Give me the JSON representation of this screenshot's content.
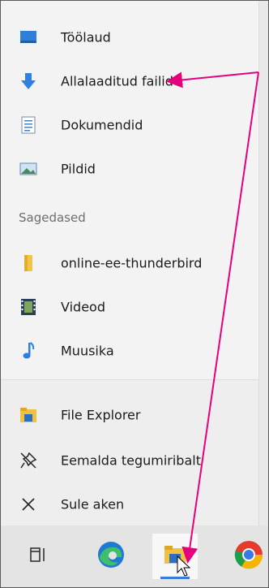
{
  "quick_access": [
    {
      "label": "Töölaud",
      "icon": "desktop-icon"
    },
    {
      "label": "Allalaaditud failid",
      "icon": "download-arrow-icon"
    },
    {
      "label": "Dokumendid",
      "icon": "document-icon"
    },
    {
      "label": "Pildid",
      "icon": "pictures-icon"
    }
  ],
  "frequent": {
    "header": "Sagedased",
    "items": [
      {
        "label": "online-ee-thunderbird",
        "icon": "folder-icon"
      },
      {
        "label": "Videod",
        "icon": "video-icon"
      },
      {
        "label": "Muusika",
        "icon": "music-note-icon"
      }
    ]
  },
  "actions": [
    {
      "label": "File Explorer",
      "icon": "file-explorer-icon"
    },
    {
      "label": "Eemalda tegumiribalt",
      "icon": "unpin-icon"
    },
    {
      "label": "Sule aken",
      "icon": "close-icon"
    }
  ],
  "taskbar": [
    "task-view-icon",
    "edge-icon",
    "file-explorer-icon",
    "chrome-icon"
  ],
  "colors": {
    "annotation_arrow": "#e6007e",
    "accent": "#3a7bd5"
  }
}
